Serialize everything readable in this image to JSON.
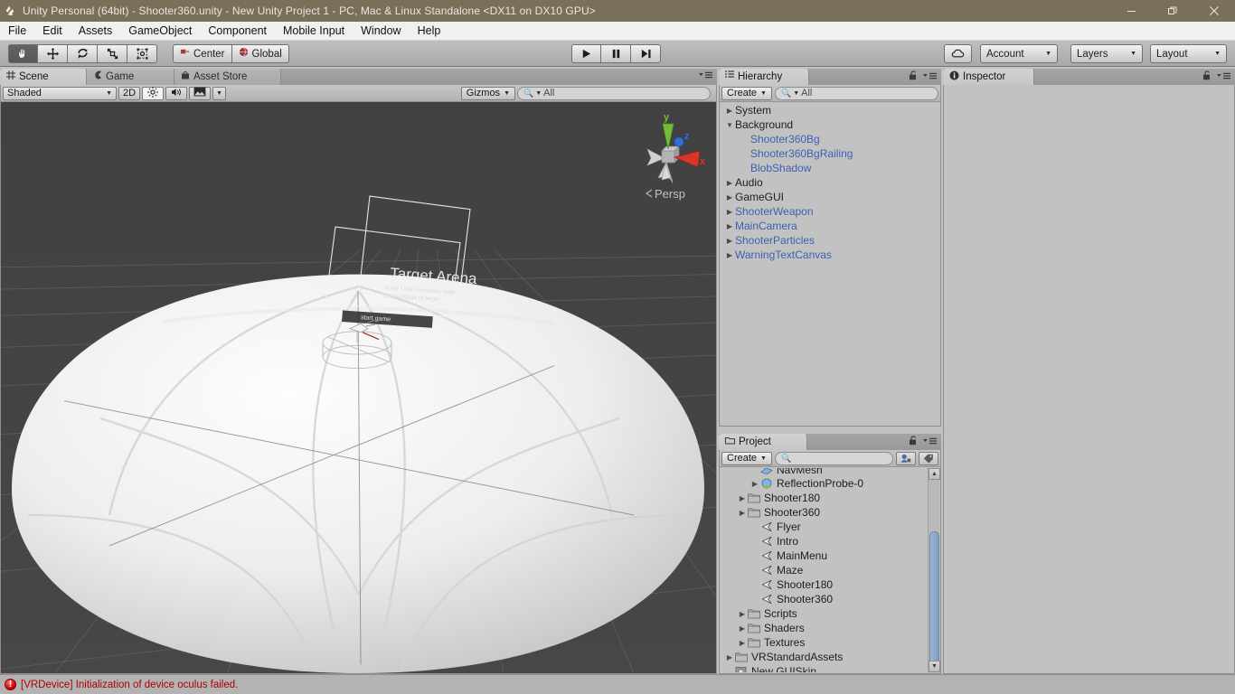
{
  "window": {
    "title": "Unity Personal (64bit) - Shooter360.unity - New Unity Project 1 - PC, Mac & Linux Standalone <DX11 on DX10 GPU>",
    "app_icon": "unity-icon",
    "minimize": "—",
    "maximize": "❐",
    "close": "✕"
  },
  "menubar": {
    "items": [
      "File",
      "Edit",
      "Assets",
      "GameObject",
      "Component",
      "Mobile Input",
      "Window",
      "Help"
    ]
  },
  "toolbar": {
    "tools": [
      {
        "name": "hand-tool",
        "glyph": "✋",
        "active": true
      },
      {
        "name": "move-tool",
        "glyph": "✥",
        "active": false
      },
      {
        "name": "rotate-tool",
        "glyph": "⟳",
        "active": false
      },
      {
        "name": "scale-tool",
        "glyph": "⤡",
        "active": false
      },
      {
        "name": "rect-tool",
        "glyph": "⧉",
        "active": false
      }
    ],
    "pivot_mode": "Center",
    "pivot_rotation": "Global",
    "play": "▶",
    "pause": "❙❙",
    "step": "▶❙",
    "cloud": "☁",
    "account": "Account",
    "layers": "Layers",
    "layout": "Layout"
  },
  "scene_panel": {
    "tabs": [
      {
        "label": "Scene",
        "icon": "grid-icon",
        "active": true
      },
      {
        "label": "Game",
        "icon": "gamepad-icon",
        "active": false
      },
      {
        "label": "Asset Store",
        "icon": "store-icon",
        "active": false
      }
    ],
    "draw_mode": "Shaded",
    "mode_2d": "2D",
    "lighting_icon": "sun-icon",
    "audio_icon": "speaker-icon",
    "effects_icon": "image-icon",
    "gizmos": "Gizmos",
    "search_placeholder": "All",
    "search_value": "",
    "projection_label": "Persp",
    "axis_labels": {
      "x": "x",
      "y": "y",
      "z": "z"
    },
    "axis_colors": {
      "x": "#d6372c",
      "y": "#6fbd3a",
      "z": "#2f6fd6"
    },
    "background_color": "#434343",
    "scene_text": "Target Arena"
  },
  "hierarchy": {
    "tab_label": "Hierarchy",
    "tab_icon": "hierarchy-icon",
    "create_label": "Create",
    "search_placeholder": "All",
    "search_value": "",
    "lock_icon": "lock-open-icon",
    "menu_icon": "panel-menu-icon",
    "items": [
      {
        "label": "System",
        "depth": 0,
        "arrow": "collapsed",
        "prefab": false
      },
      {
        "label": "Background",
        "depth": 0,
        "arrow": "expanded",
        "prefab": false
      },
      {
        "label": "Shooter360Bg",
        "depth": 1,
        "arrow": "none",
        "prefab": true
      },
      {
        "label": "Shooter360BgRailing",
        "depth": 1,
        "arrow": "none",
        "prefab": true
      },
      {
        "label": "BlobShadow",
        "depth": 1,
        "arrow": "none",
        "prefab": true
      },
      {
        "label": "Audio",
        "depth": 0,
        "arrow": "collapsed",
        "prefab": false
      },
      {
        "label": "GameGUI",
        "depth": 0,
        "arrow": "collapsed",
        "prefab": false
      },
      {
        "label": "ShooterWeapon",
        "depth": 0,
        "arrow": "collapsed",
        "prefab": true
      },
      {
        "label": "MainCamera",
        "depth": 0,
        "arrow": "collapsed",
        "prefab": true
      },
      {
        "label": "ShooterParticles",
        "depth": 0,
        "arrow": "collapsed",
        "prefab": true
      },
      {
        "label": "WarningTextCanvas",
        "depth": 0,
        "arrow": "collapsed",
        "prefab": true
      }
    ]
  },
  "project": {
    "tab_label": "Project",
    "tab_icon": "folder-icon",
    "create_label": "Create",
    "search_placeholder": "",
    "search_value": "",
    "lock_icon": "lock-open-icon",
    "menu_icon": "panel-menu-icon",
    "filter_type_icon": "filter-by-type-icon",
    "filter_label_icon": "filter-by-label-icon",
    "items": [
      {
        "label": "NavMesh",
        "depth": 2,
        "arrow": "none",
        "icon": "navmesh-icon",
        "clipped": true
      },
      {
        "label": "ReflectionProbe-0",
        "depth": 2,
        "arrow": "collapsed",
        "icon": "probe-icon",
        "clipped": false
      },
      {
        "label": "Shooter180",
        "depth": 1,
        "arrow": "collapsed",
        "icon": "folder-icon",
        "clipped": false
      },
      {
        "label": "Shooter360",
        "depth": 1,
        "arrow": "collapsed",
        "icon": "folder-icon",
        "clipped": false
      },
      {
        "label": "Flyer",
        "depth": 2,
        "arrow": "none",
        "icon": "scene-icon",
        "clipped": false
      },
      {
        "label": "Intro",
        "depth": 2,
        "arrow": "none",
        "icon": "scene-icon",
        "clipped": false
      },
      {
        "label": "MainMenu",
        "depth": 2,
        "arrow": "none",
        "icon": "scene-icon",
        "clipped": false
      },
      {
        "label": "Maze",
        "depth": 2,
        "arrow": "none",
        "icon": "scene-icon",
        "clipped": false
      },
      {
        "label": "Shooter180",
        "depth": 2,
        "arrow": "none",
        "icon": "scene-icon",
        "clipped": false
      },
      {
        "label": "Shooter360",
        "depth": 2,
        "arrow": "none",
        "icon": "scene-icon",
        "clipped": false
      },
      {
        "label": "Scripts",
        "depth": 1,
        "arrow": "collapsed",
        "icon": "folder-icon",
        "clipped": false
      },
      {
        "label": "Shaders",
        "depth": 1,
        "arrow": "collapsed",
        "icon": "folder-icon",
        "clipped": false
      },
      {
        "label": "Textures",
        "depth": 1,
        "arrow": "collapsed",
        "icon": "folder-icon",
        "clipped": false
      },
      {
        "label": "VRStandardAssets",
        "depth": 0,
        "arrow": "collapsed",
        "icon": "folder-icon",
        "clipped": false
      },
      {
        "label": "New GUISkin",
        "depth": 0,
        "arrow": "none",
        "icon": "guiskin-icon",
        "clipped": false
      }
    ]
  },
  "inspector": {
    "tab_label": "Inspector",
    "tab_icon": "info-icon",
    "lock_icon": "lock-open-icon",
    "menu_icon": "panel-menu-icon"
  },
  "statusbar": {
    "icon": "error-icon",
    "message": "[VRDevice] Initialization of device oculus failed.",
    "color": "#b00000"
  }
}
